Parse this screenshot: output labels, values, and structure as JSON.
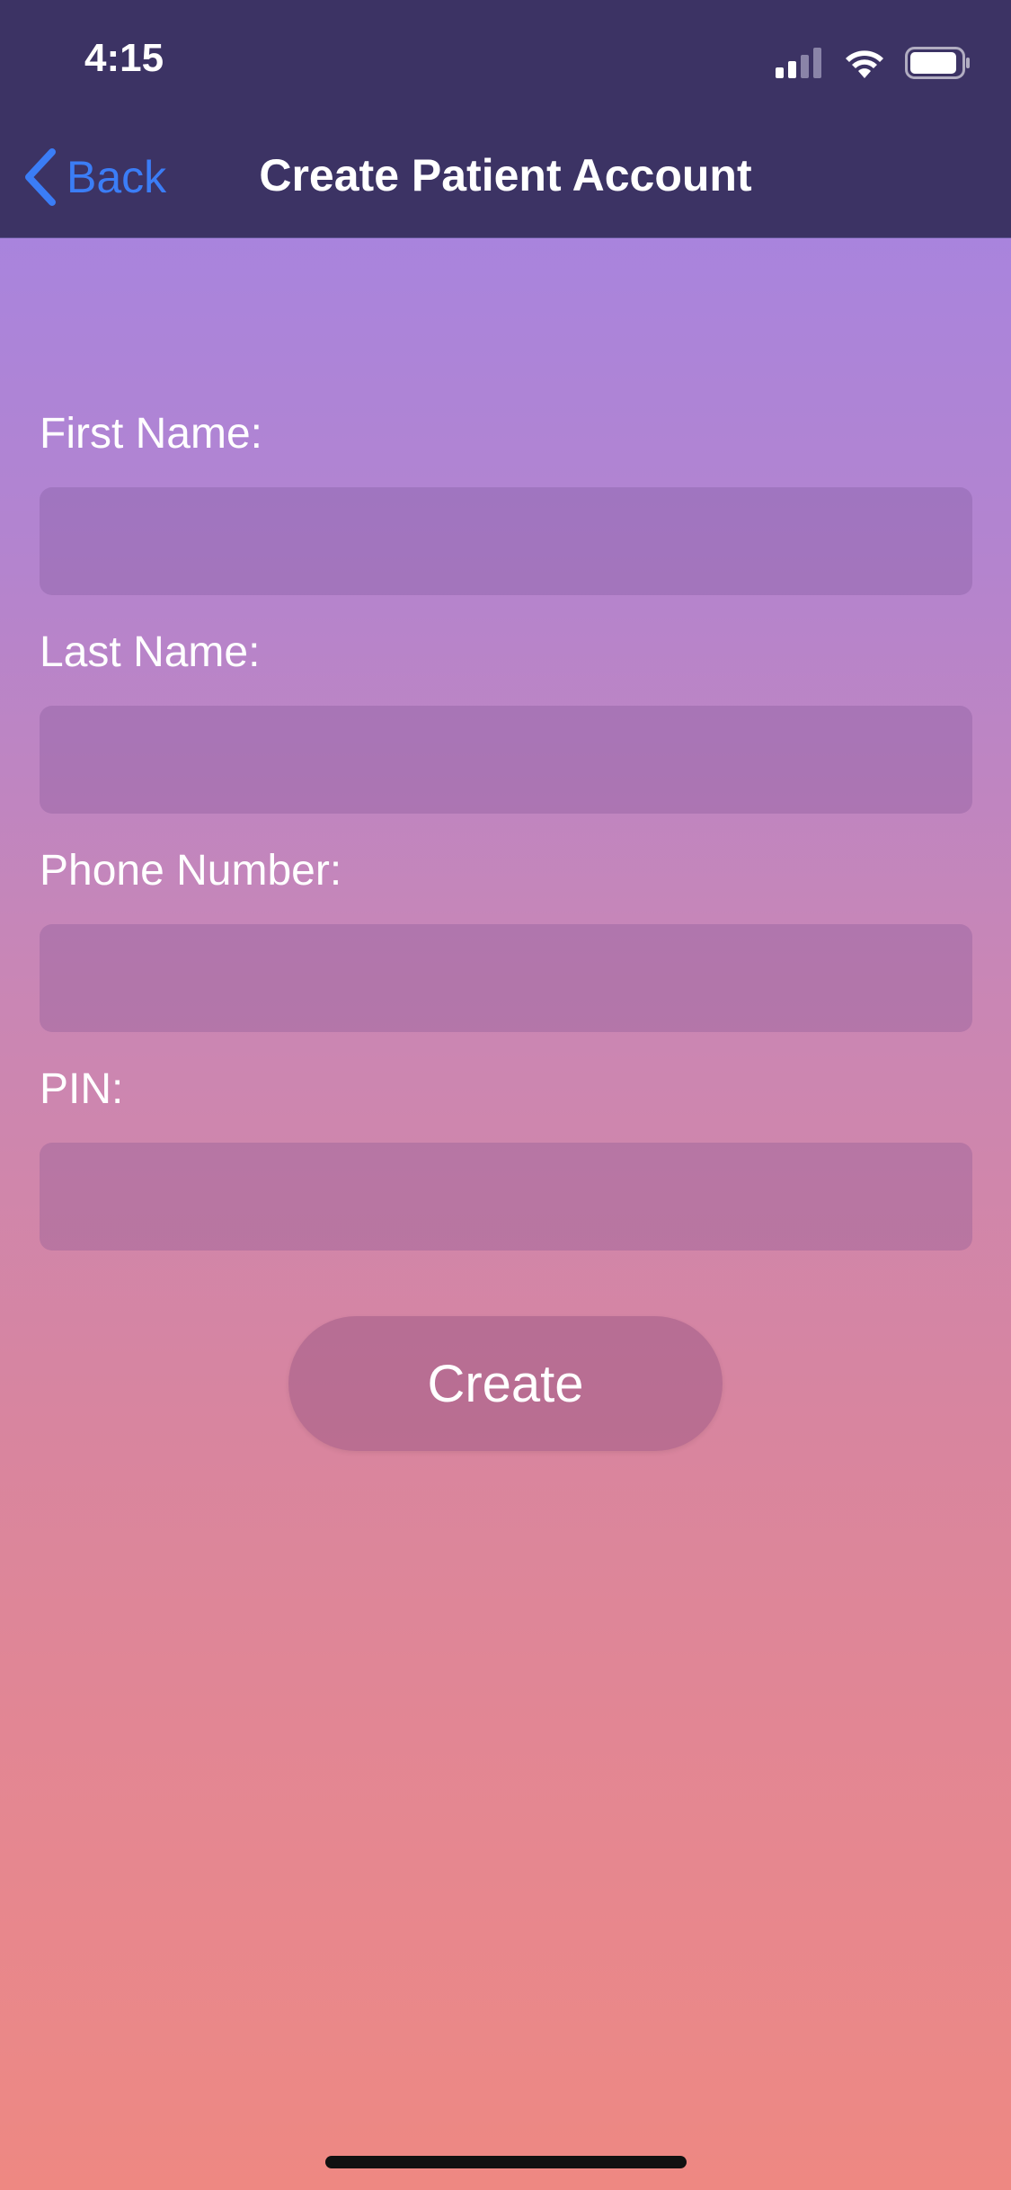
{
  "status_bar": {
    "time": "4:15",
    "icons": [
      "cellular-signal-icon",
      "wifi-icon",
      "battery-icon"
    ]
  },
  "nav": {
    "back_label": "Back",
    "title": "Create Patient Account",
    "back_icon": "chevron-left-icon"
  },
  "form": {
    "fields": [
      {
        "label": "First Name:",
        "value": "",
        "placeholder": ""
      },
      {
        "label": "Last Name:",
        "value": "",
        "placeholder": ""
      },
      {
        "label": "Phone Number:",
        "value": "",
        "placeholder": ""
      },
      {
        "label": "PIN:",
        "value": "",
        "placeholder": ""
      }
    ],
    "submit_label": "Create"
  },
  "colors": {
    "nav_background": "#3c3364",
    "accent": "#3b7df6",
    "gradient_top": "#a183e8",
    "gradient_bottom": "#ee8882"
  }
}
